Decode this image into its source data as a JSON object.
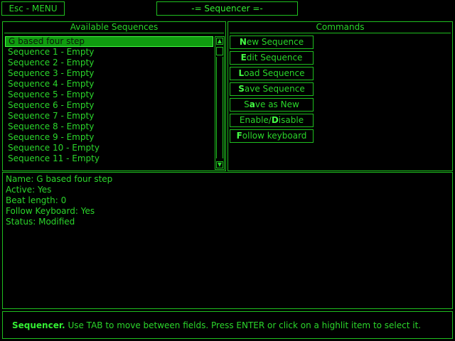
{
  "menu_button": {
    "label": "Esc - MENU"
  },
  "window_title": "-= Sequencer =-",
  "sequences_panel": {
    "header": "Available Sequences",
    "items": [
      "G based four step",
      "Sequence 1 - Empty",
      "Sequence 2 - Empty",
      "Sequence 3 - Empty",
      "Sequence 4 - Empty",
      "Sequence 5 - Empty",
      "Sequence 6 - Empty",
      "Sequence 7 - Empty",
      "Sequence 8 - Empty",
      "Sequence 9 - Empty",
      "Sequence 10 - Empty",
      "Sequence 11 - Empty"
    ],
    "selected_index": 0
  },
  "commands_panel": {
    "header": "Commands",
    "buttons": [
      {
        "hot": "N",
        "rest": "ew Sequence"
      },
      {
        "hot": "E",
        "rest": "dit Sequence"
      },
      {
        "hot": "L",
        "rest": "oad Sequence"
      },
      {
        "hot": "S",
        "rest": "ave Sequence"
      },
      {
        "pre": "S",
        "hot": "a",
        "rest": "ve as New"
      },
      {
        "pre": "Enable/",
        "hot": "D",
        "rest": "isable"
      },
      {
        "hot": "F",
        "rest": "ollow keyboard"
      }
    ]
  },
  "details": {
    "name": "Name: G based four step",
    "active": "Active: Yes",
    "beat_length": "Beat length: 0",
    "follow_keyboard": "Follow Keyboard: Yes",
    "status": "Status: Modified"
  },
  "status_bar": {
    "bold": "Sequencer.",
    "text": " Use TAB to move between fields. Press ENTER or click on a highlit item to select it."
  },
  "colors": {
    "foreground": "#22cc22",
    "background": "#000000",
    "highlight": "#0f9c0f"
  }
}
